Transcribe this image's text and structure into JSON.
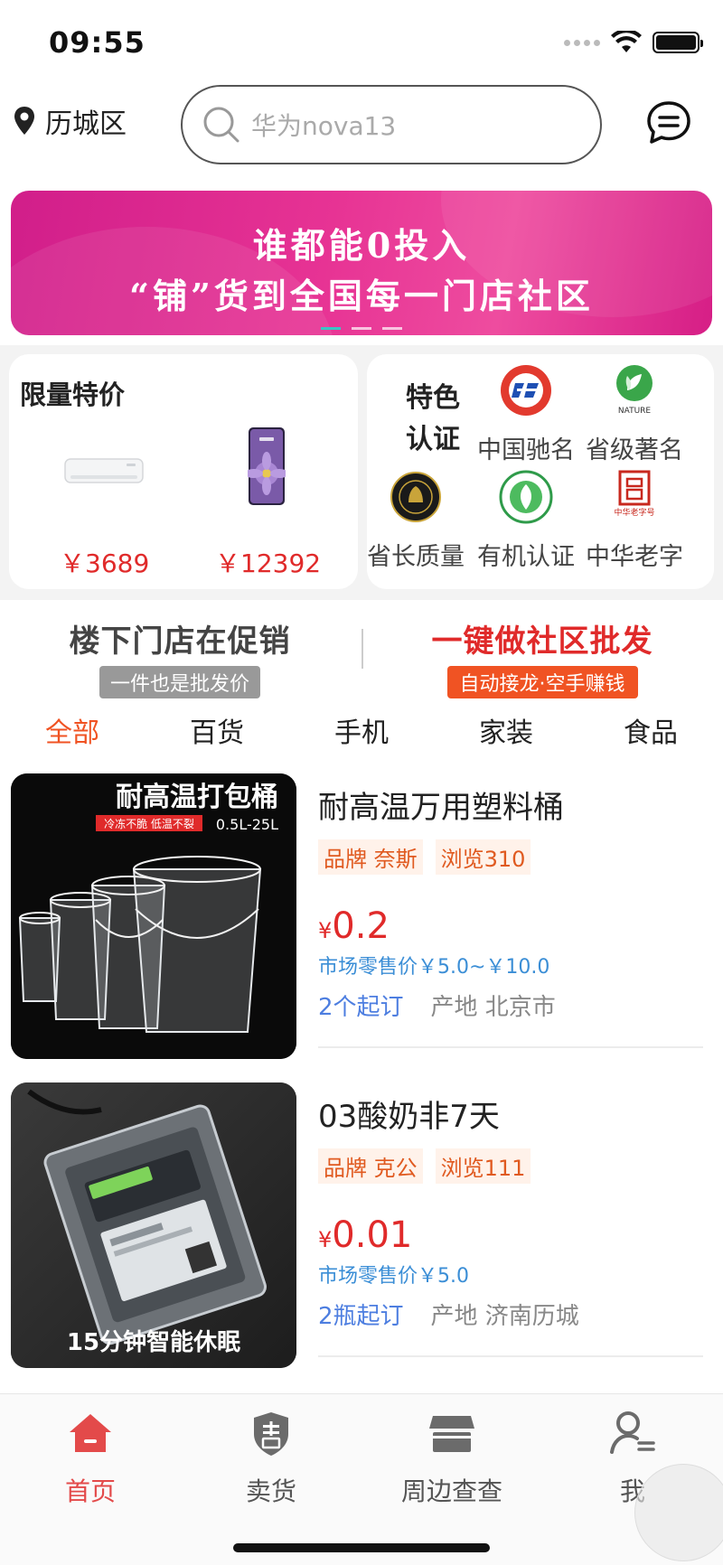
{
  "status": {
    "time": "09:55"
  },
  "header": {
    "location": "历城区",
    "search_placeholder": "华为nova13"
  },
  "banner": {
    "line1": "谁都能0投入",
    "line2": "“铺”货到全国每一门店社区"
  },
  "special_offer": {
    "title": "限量特价",
    "items": [
      {
        "name": "air-conditioner",
        "price": "￥3689"
      },
      {
        "name": "smartphone",
        "price": "￥12392"
      }
    ]
  },
  "certification": {
    "title": "特色认证",
    "badges": [
      {
        "label": "中国驰名",
        "icon": "china-famous-brand-icon"
      },
      {
        "label": "省级著名",
        "icon": "nature-leaf-icon"
      },
      {
        "label": "省长质量",
        "icon": "governor-quality-seal-icon"
      },
      {
        "label": "有机认证",
        "icon": "organic-cert-icon"
      },
      {
        "label": "中华老字",
        "icon": "chinese-time-honored-brand-icon"
      }
    ],
    "logo_text": {
      "nature": "NATURE",
      "laozihao": "中华老字号"
    }
  },
  "promo": {
    "left_title": "楼下门店在促销",
    "left_sub": "一件也是批发价",
    "right_title": "一键做社区批发",
    "right_sub": "自动接龙·空手赚钱"
  },
  "tabs": [
    {
      "label": "全部",
      "active": true
    },
    {
      "label": "百货",
      "active": false
    },
    {
      "label": "手机",
      "active": false
    },
    {
      "label": "家装",
      "active": false
    },
    {
      "label": "食品",
      "active": false
    }
  ],
  "products": [
    {
      "name": "耐高温万用塑料桶",
      "brand_tag": "品牌 奈斯",
      "views_tag": "浏览310",
      "currency": "¥",
      "price": "0.2",
      "retail": "市场零售价￥5.0~￥10.0",
      "moq": "2个起订",
      "origin": "产地 北京市",
      "image_title": "耐高温打包桶",
      "image_sub": "冷冻不脆 低温不裂",
      "image_size": "0.5L-25L"
    },
    {
      "name": "03酸奶非7天",
      "brand_tag": "品牌 克公",
      "views_tag": "浏览111",
      "currency": "¥",
      "price": "0.01",
      "retail": "市场零售价￥5.0",
      "moq": "2瓶起订",
      "origin": "产地 济南历城",
      "image_caption": "15分钟智能休眠"
    }
  ],
  "bottom_nav": [
    {
      "label": "首页",
      "icon": "home-icon",
      "active": true
    },
    {
      "label": "卖货",
      "icon": "sell-shield-icon",
      "active": false
    },
    {
      "label": "周边查查",
      "icon": "store-icon",
      "active": false
    },
    {
      "label": "我",
      "icon": "user-icon",
      "active": false
    }
  ],
  "colors": {
    "accent": "#f05323",
    "price": "#e02a2a",
    "banner": "#e73394",
    "link": "#3b8ed6"
  }
}
